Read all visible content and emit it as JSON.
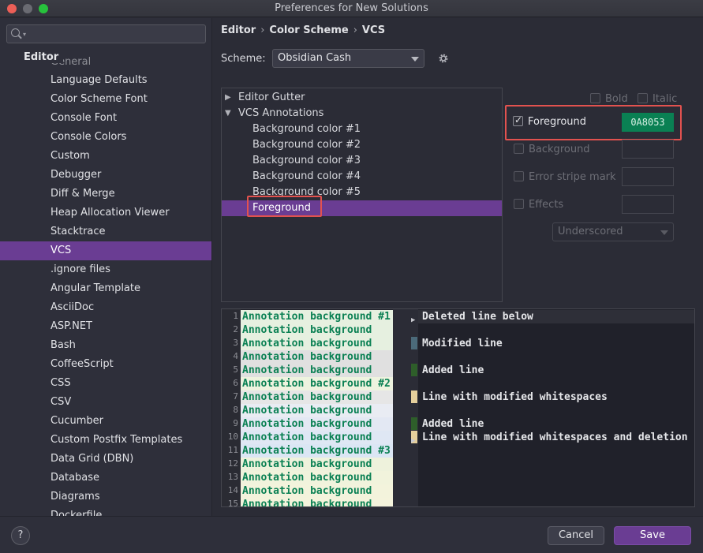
{
  "window": {
    "title": "Preferences for New Solutions"
  },
  "sidebar": {
    "search_placeholder": "",
    "section": "Editor",
    "partial_item": "General",
    "items": [
      "Language Defaults",
      "Color Scheme Font",
      "Console Font",
      "Console Colors",
      "Custom",
      "Debugger",
      "Diff & Merge",
      "Heap Allocation Viewer",
      "Stacktrace",
      "VCS",
      ".ignore files",
      "Angular Template",
      "AsciiDoc",
      "ASP.NET",
      "Bash",
      "CoffeeScript",
      "CSS",
      "CSV",
      "Cucumber",
      "Custom Postfix Templates",
      "Data Grid (DBN)",
      "Database",
      "Diagrams",
      "Dockerfile"
    ],
    "selected": "VCS"
  },
  "breadcrumb": {
    "a": "Editor",
    "b": "Color Scheme",
    "c": "VCS",
    "sep": "›"
  },
  "scheme": {
    "label": "Scheme:",
    "value": "Obsidian Cash"
  },
  "tree": {
    "editor_gutter": "Editor Gutter",
    "vcs_annotations": "VCS Annotations",
    "children": [
      "Background color #1",
      "Background color #2",
      "Background color #3",
      "Background color #4",
      "Background color #5",
      "Foreground"
    ],
    "selected": "Foreground"
  },
  "attributes": {
    "bold": "Bold",
    "italic": "Italic",
    "foreground": "Foreground",
    "foreground_checked": true,
    "foreground_value": "0A8053",
    "foreground_color": "#0a8053",
    "background": "Background",
    "error_stripe": "Error stripe mark",
    "effects": "Effects",
    "effects_style": "Underscored"
  },
  "preview": {
    "annotations": [
      {
        "n": "1",
        "text": "Annotation background #1",
        "bg": "#e6f0e0"
      },
      {
        "n": "2",
        "text": "Annotation background",
        "bg": "#e6f0e0"
      },
      {
        "n": "3",
        "text": "Annotation background",
        "bg": "#e6f0e0"
      },
      {
        "n": "4",
        "text": "Annotation background",
        "bg": "#e0e0e0"
      },
      {
        "n": "5",
        "text": "Annotation background",
        "bg": "#e0e0e0"
      },
      {
        "n": "6",
        "text": "Annotation background #2",
        "bg": "#eef3df"
      },
      {
        "n": "7",
        "text": "Annotation background",
        "bg": "#e6e6e6"
      },
      {
        "n": "8",
        "text": "Annotation background",
        "bg": "#e9ecf3"
      },
      {
        "n": "9",
        "text": "Annotation background",
        "bg": "#e3e8f3"
      },
      {
        "n": "10",
        "text": "Annotation background",
        "bg": "#dfe7f4"
      },
      {
        "n": "11",
        "text": "Annotation background #3",
        "bg": "#dbe6f4"
      },
      {
        "n": "12",
        "text": "Annotation background",
        "bg": "#eef2dc"
      },
      {
        "n": "13",
        "text": "Annotation background",
        "bg": "#f1f3dc"
      },
      {
        "n": "14",
        "text": "Annotation background",
        "bg": "#f3f3dc"
      },
      {
        "n": "15",
        "text": "Annotation background",
        "bg": "#f4f3dc"
      }
    ],
    "lines": {
      "deleted": "Deleted line below",
      "modified": "Modified line",
      "added1": "Added line",
      "whitespace": "Line with modified whitespaces",
      "added2": "Added line",
      "whitespace_del": "Line with modified whitespaces and deletion"
    }
  },
  "footer": {
    "help": "?",
    "cancel": "Cancel",
    "save": "Save"
  }
}
